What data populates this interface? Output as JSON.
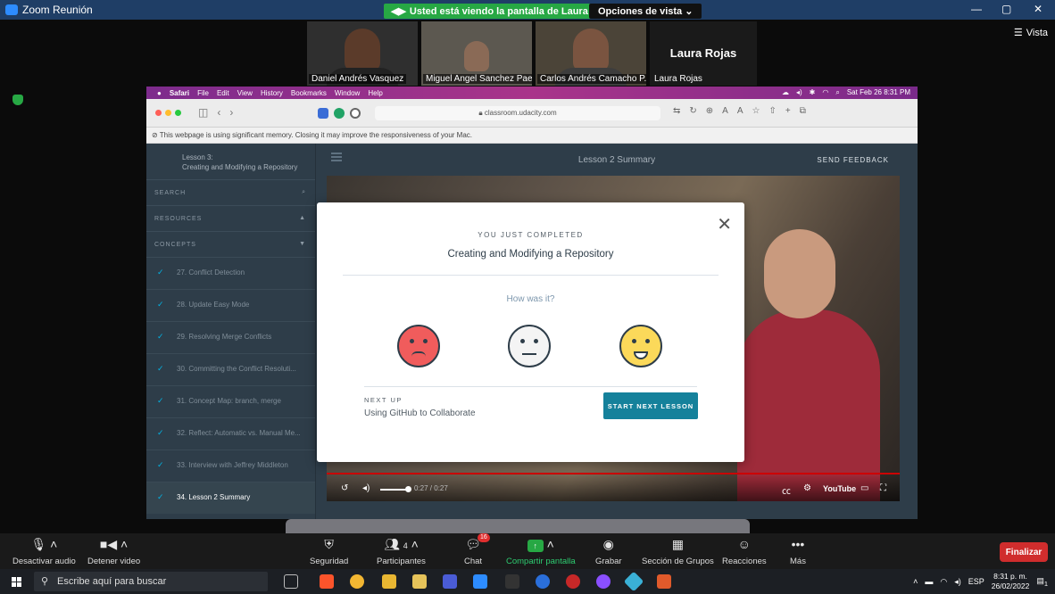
{
  "zoom": {
    "window_title": "Zoom Reunión",
    "share_banner": "Usted está viendo la pantalla de Laura Rojas",
    "view_options": "Opciones de vista ⌄",
    "vista_label": "Vista",
    "participants": [
      {
        "name": "Daniel Andrés Vasquez"
      },
      {
        "name": "Miguel Angel Sanchez Paez"
      },
      {
        "name": "Carlos Andrés Camacho P..."
      },
      {
        "name": "Laura Rojas",
        "big_name": "Laura Rojas"
      }
    ]
  },
  "mac": {
    "menubar": [
      "Safari",
      "File",
      "Edit",
      "View",
      "History",
      "Bookmarks",
      "Window",
      "Help"
    ],
    "datetime": "Sat Feb 26  8:31 PM",
    "url": "classroom.udacity.com",
    "warning": "This webpage is using significant memory. Closing it may improve the responsiveness of your Mac."
  },
  "udacity": {
    "lesson_label": "Lesson 3:",
    "lesson_title": "Creating and Modifying a Repository",
    "search": "SEARCH",
    "resources": "RESOURCES",
    "concepts": "CONCEPTS",
    "concept_items": [
      "27. Conflict Detection",
      "28. Update Easy Mode",
      "29. Resolving Merge Conflicts",
      "30. Committing the Conflict Resoluti...",
      "31. Concept Map: branch, merge",
      "32. Reflect: Automatic vs. Manual Me...",
      "33. Interview with Jeffrey Middleton",
      "34. Lesson 2 Summary"
    ],
    "page_title": "Lesson 2 Summary",
    "send_feedback": "SEND FEEDBACK",
    "video_time": "0:27 / 0:27",
    "youtube": "YouTube"
  },
  "modal": {
    "kicker": "YOU JUST COMPLETED",
    "title": "Creating and Modifying a Repository",
    "prompt": "How was it?",
    "next_up": "NEXT UP",
    "next_title": "Using GitHub to Collaborate",
    "start_button": "START NEXT LESSON"
  },
  "toolbar": {
    "mute": "Desactivar audio",
    "stop_video": "Detener video",
    "security": "Seguridad",
    "participants": "Participantes",
    "participants_count": "4",
    "chat": "Chat",
    "chat_badge": "16",
    "share": "Compartir pantalla",
    "record": "Grabar",
    "breakout": "Sección de Grupos",
    "reactions": "Reacciones",
    "more": "Más",
    "end": "Finalizar"
  },
  "taskbar": {
    "search_placeholder": "Escribe aquí para buscar",
    "lang": "ESP",
    "time": "8:31 p. m.",
    "date": "26/02/2022",
    "notif": "1"
  }
}
